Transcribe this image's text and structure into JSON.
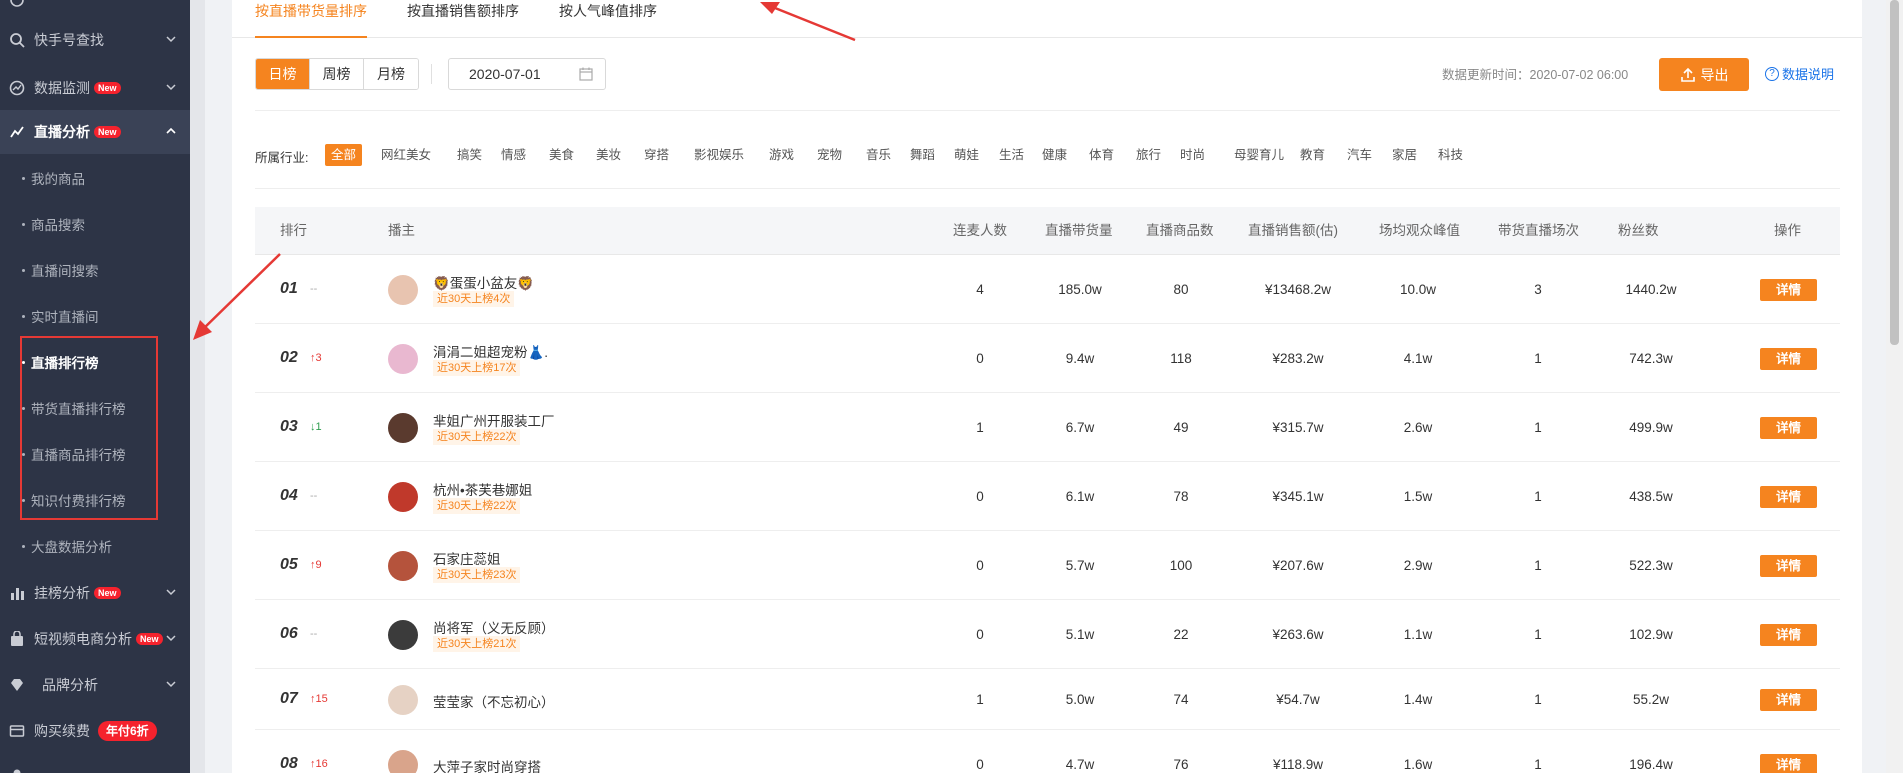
{
  "sidebar": {
    "items": [
      {
        "label": "快手号查找",
        "icon": "search-icon",
        "new": false
      },
      {
        "label": "数据监测",
        "icon": "monitor-icon",
        "new": true
      },
      {
        "label": "直播分析",
        "icon": "live-analysis-icon",
        "new": true,
        "expanded": true
      },
      {
        "label": "挂榜分析",
        "icon": "bar-chart-icon",
        "new": true
      },
      {
        "label": "短视频电商分析",
        "icon": "shopping-bag-icon",
        "new": true
      },
      {
        "label": "品牌分析",
        "icon": "diamond-icon",
        "new": false
      },
      {
        "label": "购买续费",
        "icon": "card-icon",
        "promo": "年付6折"
      }
    ],
    "new_badge": "New",
    "subitems": [
      "我的商品",
      "商品搜索",
      "直播间搜索",
      "实时直播间",
      "直播排行榜",
      "带货直播排行榜",
      "直播商品排行榜",
      "知识付费排行榜",
      "大盘数据分析"
    ],
    "current_sub": "直播排行榜"
  },
  "tabs": [
    "按直播带货量排序",
    "按直播销售额排序",
    "按人气峰值排序"
  ],
  "period_buttons": [
    "日榜",
    "周榜",
    "月榜"
  ],
  "date_value": "2020-07-01",
  "update_time": "数据更新时间：2020-07-02 06:00",
  "export_label": "导出",
  "help_label": "数据说明",
  "industry_label": "所属行业:",
  "industries": [
    "全部",
    "网红美女",
    "搞笑",
    "情感",
    "美食",
    "美妆",
    "穿搭",
    "影视娱乐",
    "游戏",
    "宠物",
    "音乐",
    "舞蹈",
    "萌娃",
    "生活",
    "健康",
    "体育",
    "旅行",
    "时尚",
    "母婴育儿",
    "教育",
    "汽车",
    "家居",
    "科技"
  ],
  "table": {
    "headers": [
      "排行",
      "播主",
      "连麦人数",
      "直播带货量",
      "直播商品数",
      "直播销售额(估)",
      "场均观众峰值",
      "带货直播场次",
      "粉丝数",
      "操作"
    ],
    "detail_label": "详情",
    "rows": [
      {
        "rank": "01",
        "change": "--",
        "dir": "same",
        "name": "🦁蛋蛋小盆友🦁",
        "tag": "近30天上榜4次",
        "lianmai": "4",
        "volume": "185.0w",
        "products": "80",
        "sales": "¥13468.2w",
        "peak": "10.0w",
        "sessions": "3",
        "fans": "1440.2w",
        "avatar": "#e8c4b0"
      },
      {
        "rank": "02",
        "change": "3",
        "dir": "up",
        "name": "涓涓二姐超宠粉👗.",
        "tag": "近30天上榜17次",
        "lianmai": "0",
        "volume": "9.4w",
        "products": "118",
        "sales": "¥283.2w",
        "peak": "4.1w",
        "sessions": "1",
        "fans": "742.3w",
        "avatar": "#e9b8d0"
      },
      {
        "rank": "03",
        "change": "1",
        "dir": "down",
        "name": "芈姐广州开服装工厂",
        "tag": "近30天上榜22次",
        "lianmai": "1",
        "volume": "6.7w",
        "products": "49",
        "sales": "¥315.7w",
        "peak": "2.6w",
        "sessions": "1",
        "fans": "499.9w",
        "avatar": "#5a3a2e"
      },
      {
        "rank": "04",
        "change": "--",
        "dir": "same",
        "name": "杭州•茶芙巷娜姐",
        "tag": "近30天上榜22次",
        "lianmai": "0",
        "volume": "6.1w",
        "products": "78",
        "sales": "¥345.1w",
        "peak": "1.5w",
        "sessions": "1",
        "fans": "438.5w",
        "avatar": "#c0392b"
      },
      {
        "rank": "05",
        "change": "9",
        "dir": "up",
        "name": "石家庄蕊姐",
        "tag": "近30天上榜23次",
        "lianmai": "0",
        "volume": "5.7w",
        "products": "100",
        "sales": "¥207.6w",
        "peak": "2.9w",
        "sessions": "1",
        "fans": "522.3w",
        "avatar": "#b5533c"
      },
      {
        "rank": "06",
        "change": "--",
        "dir": "same",
        "name": "尚将军（义无反顾）",
        "tag": "近30天上榜21次",
        "lianmai": "0",
        "volume": "5.1w",
        "products": "22",
        "sales": "¥263.6w",
        "peak": "1.1w",
        "sessions": "1",
        "fans": "102.9w",
        "avatar": "#3b3b3b"
      },
      {
        "rank": "07",
        "change": "15",
        "dir": "up",
        "name": "莹莹家（不忘初心）",
        "tag": "",
        "lianmai": "1",
        "volume": "5.0w",
        "products": "74",
        "sales": "¥54.7w",
        "peak": "1.4w",
        "sessions": "1",
        "fans": "55.2w",
        "avatar": "#e6d2c4"
      },
      {
        "rank": "08",
        "change": "16",
        "dir": "up",
        "name": "大萍子家时尚穿搭",
        "tag": "",
        "lianmai": "0",
        "volume": "4.7w",
        "products": "76",
        "sales": "¥118.9w",
        "peak": "1.6w",
        "sessions": "1",
        "fans": "196.4w",
        "avatar": "#d9a48b"
      }
    ]
  },
  "colors": {
    "accent": "#f5841f",
    "sidebar": "#2d3446",
    "up": "#e53935",
    "down": "#2e9e4f",
    "annotation": "#e53935"
  }
}
